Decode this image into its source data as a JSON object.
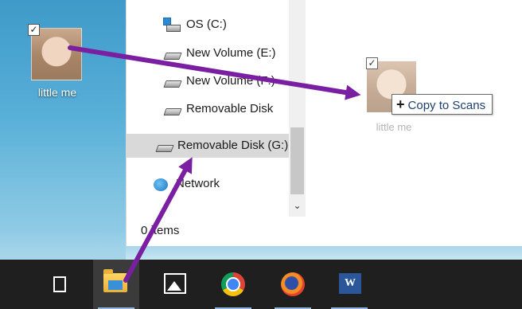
{
  "desktop": {
    "icon_label": "little me",
    "icon_checked": "✓"
  },
  "nav": {
    "items": [
      {
        "label": "OS (C:)",
        "icon": "os-drive-icon"
      },
      {
        "label": "New Volume (E:)",
        "icon": "drive-icon"
      },
      {
        "label": "New Volume (F:)",
        "icon": "drive-icon"
      },
      {
        "label": "Removable Disk",
        "icon": "drive-icon"
      },
      {
        "label": "Removable Disk (G:)",
        "icon": "drive-icon"
      },
      {
        "label": "Network",
        "icon": "network-icon"
      }
    ],
    "items_count": "0 items",
    "scroll_down": "⌄"
  },
  "drag": {
    "ghost_label": "little me",
    "ghost_checked": "✓",
    "tooltip_plus": "+",
    "tooltip_text": "Copy to Scans"
  },
  "taskbar": {
    "buttons": [
      {
        "name": "task-view-icon"
      },
      {
        "name": "file-explorer-icon"
      },
      {
        "name": "photos-icon"
      },
      {
        "name": "chrome-icon"
      },
      {
        "name": "firefox-icon"
      },
      {
        "name": "word-icon",
        "label": "W"
      }
    ]
  },
  "colors": {
    "arrow": "#7b1fa2",
    "taskbar": "#1f1f1f",
    "selection": "#d9d9d9"
  }
}
